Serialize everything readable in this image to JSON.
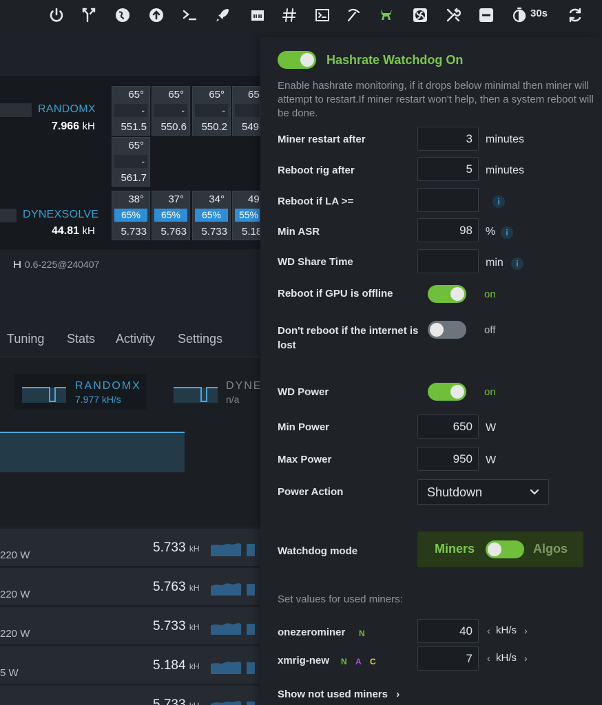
{
  "topbar": {
    "icons": [
      "power-icon",
      "network-split-icon",
      "globe-icon",
      "upload-icon",
      "terminal-icon",
      "rocket-icon",
      "ethernet-icon",
      "hash-icon",
      "console-icon",
      "pickaxe-icon",
      "watchdog-icon",
      "fan-icon",
      "tools-icon",
      "minus-icon",
      "stopwatch-icon",
      "refresh-icon"
    ],
    "timer": "30s",
    "accent_color": "#7cc84a"
  },
  "rig": {
    "algos": [
      {
        "name": "RANDOMX",
        "rate": "7.966",
        "unit": "kH"
      },
      {
        "name": "DYNEXSOLVE",
        "rate": "44.81",
        "unit": "kH"
      }
    ],
    "randomx_cards": [
      {
        "temp": "65°",
        "mid": "-",
        "hash": "551.5"
      },
      {
        "temp": "65°",
        "mid": "-",
        "hash": "550.6"
      },
      {
        "temp": "65°",
        "mid": "-",
        "hash": "550.2"
      },
      {
        "temp": "65",
        "mid": "-",
        "hash": "549"
      },
      {
        "temp": "65°",
        "mid": "-",
        "hash": "561.7"
      }
    ],
    "dynex_cards": [
      {
        "temp": "38°",
        "mid": "65%",
        "hash": "5.733"
      },
      {
        "temp": "37°",
        "mid": "65%",
        "hash": "5.763"
      },
      {
        "temp": "34°",
        "mid": "65%",
        "hash": "5.733"
      },
      {
        "temp": "49",
        "mid": "55%",
        "hash": "5.18"
      }
    ],
    "version": "0.6-225@240407"
  },
  "tabs": [
    "Tuning",
    "Stats",
    "Activity",
    "Settings"
  ],
  "mini_cards": [
    {
      "name": "RANDOMX",
      "sub": "7.977 kH/s"
    },
    {
      "name": "DYNE",
      "sub": "n/a"
    }
  ],
  "gpu_rows": [
    {
      "power": "220 W",
      "hash": "5.733",
      "unit": "kH"
    },
    {
      "power": "220 W",
      "hash": "5.763",
      "unit": "kH"
    },
    {
      "power": "220 W",
      "hash": "5.733",
      "unit": "kH"
    },
    {
      "power": "5 W",
      "hash": "5.184",
      "unit": "kH"
    },
    {
      "power": "",
      "hash": "5.733",
      "unit": "kH"
    }
  ],
  "panel": {
    "title": "Hashrate Watchdog On",
    "enabled": true,
    "description": "Enable hashrate monitoring, if it drops below minimal then miner will attempt to restart.If miner restart won't help, then a system reboot will be done.",
    "miner_restart": {
      "label": "Miner restart after",
      "value": "3",
      "unit": "minutes"
    },
    "reboot_rig": {
      "label": "Reboot rig after",
      "value": "5",
      "unit": "minutes"
    },
    "reboot_la": {
      "label": "Reboot if LA >=",
      "value": ""
    },
    "min_asr": {
      "label": "Min ASR",
      "value": "98",
      "unit": "%"
    },
    "wd_share_time": {
      "label": "WD Share Time",
      "value": "",
      "unit": "min"
    },
    "reboot_gpu_offline": {
      "label": "Reboot if GPU is offline",
      "state": "on",
      "enabled": true
    },
    "dont_reboot_internet": {
      "label": "Don't reboot if the internet is lost",
      "state": "off",
      "enabled": false
    },
    "wd_power": {
      "label": "WD Power",
      "state": "on",
      "enabled": true
    },
    "min_power": {
      "label": "Min Power",
      "value": "650",
      "unit": "W"
    },
    "max_power": {
      "label": "Max Power",
      "value": "950",
      "unit": "W"
    },
    "power_action": {
      "label": "Power Action",
      "value": "Shutdown"
    },
    "watchdog_mode": {
      "label": "Watchdog mode",
      "left": "Miners",
      "right": "Algos"
    },
    "set_values_label": "Set values for used miners:",
    "miners": [
      {
        "name": "onezerominer",
        "badges": [
          {
            "text": "N",
            "color": "#6fbf3b"
          }
        ],
        "value": "40",
        "unit": "kH/s"
      },
      {
        "name": "xmrig-new",
        "badges": [
          {
            "text": "N",
            "color": "#6fbf3b"
          },
          {
            "text": "A",
            "color": "#b04fd8"
          },
          {
            "text": "C",
            "color": "#e8d838"
          }
        ],
        "value": "7",
        "unit": "kH/s"
      }
    ],
    "show_not_used": "Show not used miners"
  },
  "info_glyph": "i",
  "arrow_left": "‹",
  "arrow_right": "›",
  "chevron_right": "›"
}
